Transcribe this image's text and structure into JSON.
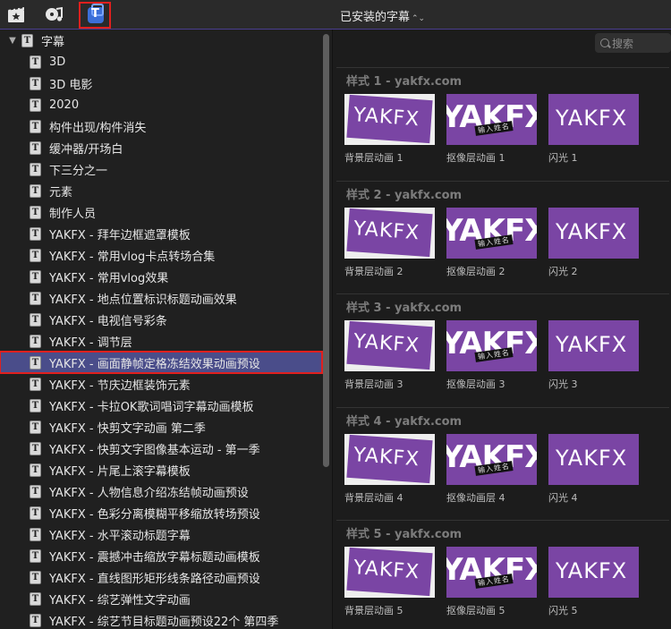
{
  "toolbar": {
    "icons": [
      "clapper-star-icon",
      "music-note-icon",
      "titles-generators-icon"
    ],
    "title": "已安装的字幕",
    "chevron": "⌃⌄"
  },
  "tree": {
    "root_label": "字幕",
    "items": [
      "3D",
      "3D 电影",
      "2020",
      "构件出现/构件消失",
      "缓冲器/开场白",
      "下三分之一",
      "元素",
      "制作人员",
      "YAKFX - 拜年边框遮罩模板",
      "YAKFX - 常用vlog卡点转场合集",
      "YAKFX - 常用vlog效果",
      "YAKFX - 地点位置标识标题动画效果",
      "YAKFX - 电视信号彩条",
      "YAKFX - 调节层",
      "YAKFX - 画面静帧定格冻结效果动画预设",
      "YAKFX - 节庆边框装饰元素",
      "YAKFX - 卡拉OK歌词唱词字幕动画模板",
      "YAKFX - 快剪文字动画 第二季",
      "YAKFX - 快剪文字图像基本运动 - 第一季",
      "YAKFX - 片尾上滚字幕模板",
      "YAKFX - 人物信息介绍冻结帧动画预设",
      "YAKFX - 色彩分离模糊平移缩放转场预设",
      "YAKFX - 水平滚动标题字幕",
      "YAKFX - 震撼冲击缩放字幕标题动画模板",
      "YAKFX - 直线图形矩形线条路径动画预设",
      "YAKFX - 综艺弹性文字动画",
      "YAKFX - 综艺节目标题动画预设22个 第四季"
    ],
    "selected_index": 14
  },
  "search": {
    "placeholder": "搜索"
  },
  "thumb_text": "YAKFX",
  "thumb_tag": "输入姓名",
  "groups": [
    {
      "title": "样式 1 - yakfx.com",
      "captions": [
        "背景层动画 1",
        "抠像层动画 1",
        "闪光 1"
      ]
    },
    {
      "title": "样式 2 - yakfx.com",
      "captions": [
        "背景层动画 2",
        "抠像层动画 2",
        "闪光 2"
      ]
    },
    {
      "title": "样式 3 - yakfx.com",
      "captions": [
        "背景层动画 3",
        "抠像层动画 3",
        "闪光 3"
      ]
    },
    {
      "title": "样式 4 - yakfx.com",
      "captions": [
        "背景层动画 4",
        "抠像动画层 4",
        "闪光 4"
      ]
    },
    {
      "title": "样式 5 - yakfx.com",
      "captions": [
        "背景层动画 5",
        "抠像层动画 5",
        "闪光 5"
      ]
    }
  ],
  "colors": {
    "accent": "#4a4d8a",
    "thumb": "#7a45a4",
    "highlight": "#e0201e"
  }
}
